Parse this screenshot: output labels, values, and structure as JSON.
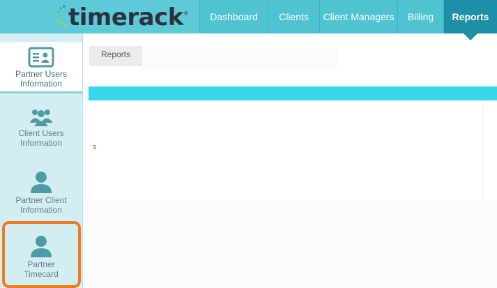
{
  "app": {
    "logo_text": "timerack",
    "logo_mark": "®"
  },
  "nav": {
    "items": [
      {
        "label": "Dashboard"
      },
      {
        "label": "Clients"
      },
      {
        "label": "Client Managers"
      },
      {
        "label": "Billing"
      },
      {
        "label": "Reports"
      }
    ],
    "active": "Reports"
  },
  "sidebar": {
    "items": [
      {
        "label_line1": "Partner Users",
        "label_line2": "Information",
        "icon": "id-card-icon"
      },
      {
        "label_line1": "Client Users",
        "label_line2": "Information",
        "icon": "users-group-icon"
      },
      {
        "label_line1": "Partner Client",
        "label_line2": "Information",
        "icon": "user-icon"
      },
      {
        "label_line1": "Partner",
        "label_line2": "Timecard",
        "icon": "user-icon"
      }
    ],
    "active_index": 0,
    "highlighted_index": 3
  },
  "content": {
    "tab_label": "Reports",
    "panel_glyph": "s"
  },
  "colors": {
    "header": "#4fc3d2",
    "active_nav": "#1d8fa6",
    "sidebar": "#d3eef2",
    "accent_bar": "#37d6e8",
    "highlight": "#f07a22",
    "icon": "#4f9aa5"
  }
}
